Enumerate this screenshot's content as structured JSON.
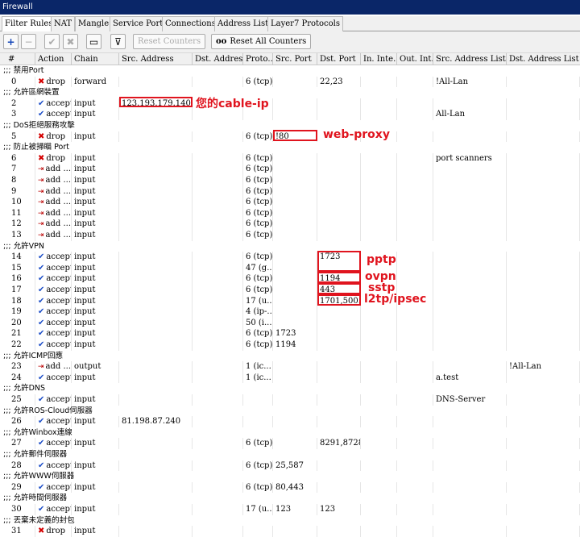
{
  "window": {
    "title": "Firewall"
  },
  "tabs": [
    {
      "label": "Filter Rules",
      "active": true
    },
    {
      "label": "NAT"
    },
    {
      "label": "Mangle"
    },
    {
      "label": "Service Ports"
    },
    {
      "label": "Connections"
    },
    {
      "label": "Address Lists"
    },
    {
      "label": "Layer7 Protocols"
    }
  ],
  "toolbar": {
    "add": "+",
    "remove": "−",
    "enable": "✔",
    "disable": "✖",
    "comment": "▭",
    "filter": "⊽",
    "reset_counters": "Reset Counters",
    "reset_all_counters": "Reset All Counters",
    "reset_all_icon": "oo"
  },
  "columns": [
    "#",
    "Action",
    "Chain",
    "Src. Address",
    "Dst. Address",
    "Proto...",
    "Src. Port",
    "Dst. Port",
    "In. Inte...",
    "Out. Int...",
    "Src. Address List",
    "Dst. Address List"
  ],
  "rows": [
    {
      "comment": ";;; 禁用Port"
    },
    {
      "n": "0",
      "action": "drop",
      "chain": "forward",
      "src": "",
      "dst": "",
      "proto": "6 (tcp)",
      "sport": "",
      "dport": "22,23",
      "srclist": "",
      "dstlist": "",
      "extra": "!All-Lan"
    },
    {
      "comment": ";;; 允許區網裝置"
    },
    {
      "n": "2",
      "action": "accept",
      "chain": "input",
      "src": "123.193.179.140",
      "dst": "",
      "proto": "",
      "sport": "",
      "dport": "",
      "srclist": "",
      "dstlist": ""
    },
    {
      "n": "3",
      "action": "accept",
      "chain": "input",
      "src": "",
      "dst": "",
      "proto": "",
      "sport": "",
      "dport": "",
      "srclist": "All-Lan",
      "dstlist": ""
    },
    {
      "comment": ";;; DoS拒絕服務攻擊"
    },
    {
      "n": "5",
      "action": "drop",
      "chain": "input",
      "src": "",
      "dst": "",
      "proto": "6 (tcp)",
      "sport": "!80",
      "dport": "",
      "srclist": "",
      "dstlist": ""
    },
    {
      "comment": ";;; 防止被掃瞄 Port"
    },
    {
      "n": "6",
      "action": "drop",
      "chain": "input",
      "src": "",
      "dst": "",
      "proto": "6 (tcp)",
      "sport": "",
      "dport": "",
      "srclist": "port scanners",
      "dstlist": ""
    },
    {
      "n": "7",
      "action": "add ...",
      "chain": "input",
      "proto": "6 (tcp)"
    },
    {
      "n": "8",
      "action": "add ...",
      "chain": "input",
      "proto": "6 (tcp)"
    },
    {
      "n": "9",
      "action": "add ...",
      "chain": "input",
      "proto": "6 (tcp)"
    },
    {
      "n": "10",
      "action": "add ...",
      "chain": "input",
      "proto": "6 (tcp)"
    },
    {
      "n": "11",
      "action": "add ...",
      "chain": "input",
      "proto": "6 (tcp)"
    },
    {
      "n": "12",
      "action": "add ...",
      "chain": "input",
      "proto": "6 (tcp)"
    },
    {
      "n": "13",
      "action": "add ...",
      "chain": "input",
      "proto": "6 (tcp)"
    },
    {
      "comment": ";;; 允許VPN"
    },
    {
      "n": "14",
      "action": "accept",
      "chain": "input",
      "proto": "6 (tcp)",
      "dport": "1723"
    },
    {
      "n": "15",
      "action": "accept",
      "chain": "input",
      "proto": "47 (g..."
    },
    {
      "n": "16",
      "action": "accept",
      "chain": "input",
      "proto": "6 (tcp)",
      "dport": "1194"
    },
    {
      "n": "17",
      "action": "accept",
      "chain": "input",
      "proto": "6 (tcp)",
      "dport": "443"
    },
    {
      "n": "18",
      "action": "accept",
      "chain": "input",
      "proto": "17 (u...",
      "dport": "1701,500..."
    },
    {
      "n": "19",
      "action": "accept",
      "chain": "input",
      "proto": "4 (ip-..."
    },
    {
      "n": "20",
      "action": "accept",
      "chain": "input",
      "proto": "50 (i..."
    },
    {
      "n": "21",
      "action": "accept",
      "chain": "input",
      "proto": "6 (tcp)",
      "sport": "1723"
    },
    {
      "n": "22",
      "action": "accept",
      "chain": "input",
      "proto": "6 (tcp)",
      "sport": "1194"
    },
    {
      "comment": ";;; 允許ICMP回應"
    },
    {
      "n": "23",
      "action": "add ...",
      "chain": "output",
      "proto": "1 (ic...",
      "dstlist": "!All-Lan"
    },
    {
      "n": "24",
      "action": "accept",
      "chain": "input",
      "proto": "1 (ic...",
      "srclist": "a.test"
    },
    {
      "comment": ";;; 允許DNS"
    },
    {
      "n": "25",
      "action": "accept",
      "chain": "input",
      "srclist": "DNS-Server"
    },
    {
      "comment": ";;; 允許ROS-Cloud伺服器"
    },
    {
      "n": "26",
      "action": "accept",
      "chain": "input",
      "src": "81.198.87.240"
    },
    {
      "comment": ";;; 允許Winbox連線"
    },
    {
      "n": "27",
      "action": "accept",
      "chain": "input",
      "proto": "6 (tcp)",
      "dport": "8291,8728"
    },
    {
      "comment": ";;; 允許郵件伺服器"
    },
    {
      "n": "28",
      "action": "accept",
      "chain": "input",
      "proto": "6 (tcp)",
      "sport": "25,587"
    },
    {
      "comment": ";;; 允許WWW伺服器"
    },
    {
      "n": "29",
      "action": "accept",
      "chain": "input",
      "proto": "6 (tcp)",
      "sport": "80,443"
    },
    {
      "comment": ";;; 允許時間伺服器"
    },
    {
      "n": "30",
      "action": "accept",
      "chain": "input",
      "proto": "17 (u...",
      "sport": "123",
      "dport": "123"
    },
    {
      "comment": ";;; 丟棄未定義的封包"
    },
    {
      "n": "31",
      "action": "drop",
      "chain": "input"
    }
  ],
  "annotations": {
    "cable_ip": "您的cable-ip",
    "web_proxy": "web-proxy",
    "pptp": "pptp",
    "ovpn": "ovpn",
    "sstp": "sstp",
    "l2tp": "l2tp/ipsec"
  },
  "colors": {
    "titlebar": "#0a2668",
    "annotation": "#e0141e",
    "drop_icon": "#d40000",
    "accept_icon": "#1e4fc8"
  }
}
